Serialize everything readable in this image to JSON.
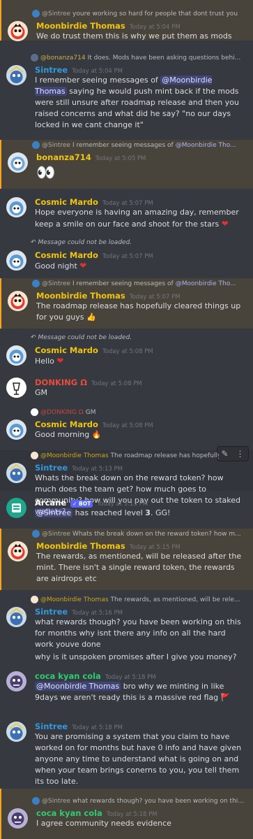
{
  "messages": [
    {
      "reply": {
        "author": "@Sintree",
        "text": "youre working so hard for people that dont trust you"
      },
      "author": "Moonbirdie Thomas",
      "time": "Today at 5:04 PM",
      "body": "We do trust them this is why we put them as mods"
    },
    {
      "reply": {
        "author": "@bonanza714",
        "text": "It does. Mods have been asking questions behi..."
      },
      "author": "Sintree",
      "time": "Today at 5:04 PM",
      "body_pre": "I remember seeing messages of ",
      "body_mention": "@Moonbirdie Thomas",
      "body_post": " saying he would push mint back if the mods were still unsure after roadmap release and then you raised concerns and what did he say? \"no our days locked in we cant change it\""
    },
    {
      "reply": {
        "author": "@Sintree",
        "text": "I remember seeing messages of ",
        "mention": "@Moonbirdie Tho..."
      },
      "author": "bonanza714",
      "time": "Today at 5:05 PM",
      "body": "👀"
    },
    {
      "author": "Cosmic Mardo",
      "time": "Today at 5:07 PM",
      "body": "Hope everyone is having an amazing day, remember keep a smile on our face and shoot for the stars",
      "emoji": "❤"
    },
    {
      "reply": {
        "text": "Message could not be loaded."
      },
      "author": "Cosmic Mardo",
      "time": "Today at 5:07 PM",
      "body": "Good night",
      "emoji": "❤"
    },
    {
      "reply": {
        "author": "@Sintree",
        "text": "I remember seeing messages of ",
        "mention": "@Moonbirdie Tho..."
      },
      "author": "Moonbirdie Thomas",
      "time": "Today at 5:07 PM",
      "body": "The roadmap release has hopefully cleared things up for you guys",
      "emoji": "👍"
    },
    {
      "reply": {
        "text": "Message could not be loaded."
      },
      "author": "Cosmic Mardo",
      "time": "Today at 5:08 PM",
      "body": "Hello",
      "emoji": "❤"
    },
    {
      "author": "DONKING Ω",
      "time": "Today at 5:08 PM",
      "body": "GM"
    },
    {
      "reply": {
        "author": "@DONKING Ω",
        "text": "GM"
      },
      "author": "Cosmic Mardo",
      "time": "Today at 5:08 PM",
      "body": "Good morning",
      "emoji": "🔥"
    },
    {
      "reply": {
        "author": "@Moonbirdie Thomas",
        "text": "The roadmap release has hopefully c..."
      },
      "author": "Sintree",
      "time": "Today at 5:13 PM",
      "body": "Whats the break down on the reward token?  how much does the team get?  how much goes to community?  how will you pay out the token to staked wallets?"
    },
    {
      "author": "Arcane",
      "bot_tag": "✓ BOT",
      "time": "Today at 5:13 PM",
      "body_mention": "@Sintree",
      "body_pre": " has reached level ",
      "body_bold": "3",
      "body_post": ". GG!"
    },
    {
      "reply": {
        "author": "@Sintree",
        "text": "Whats the break down on the reward token?  how m..."
      },
      "author": "Moonbirdie Thomas",
      "time": "Today at 5:15 PM",
      "body": "The rewards, as mentioned, will be released after the mint. There isn't a single reward token, the rewards are airdrops etc"
    },
    {
      "reply": {
        "author": "@Moonbirdie Thomas",
        "text": "The rewards, as mentioned, will be rele..."
      },
      "author": "Sintree",
      "time": "Today at 5:16 PM",
      "body": "what rewards though? you have been working on this for months why isnt there any info on all the hard work youve done",
      "body2": "why is it unspoken promises after I give you money?"
    },
    {
      "author": "coca kyan cola",
      "time": "Today at 5:18 PM",
      "body_mention": "@Moonbirdie Thomas",
      "body_post": " bro why we minting in like 9days we aren't ready this is a massive red flag",
      "emoji": "🚩"
    },
    {
      "author": "Sintree",
      "time": "Today at 5:18 PM",
      "body": "You are promising a system that you claim to have worked on for months but have 0 info and have given anyone any time to understand what is going on and when your team brings conerns to you, you tell them its too late."
    },
    {
      "reply": {
        "author": "@Sintree",
        "text": "what rewards though? you have been working on thi..."
      },
      "author": "coca kyan cola",
      "time": "Today at 5:18 PM",
      "body": "I agree community needs evidence"
    }
  ],
  "colors": {
    "moonbirdie": "#f1c40f",
    "sintree": "#3498db",
    "bonanza": "#f1c40f",
    "cosmic": "#f1c40f",
    "donking": "#e74c3c",
    "arcane": "#ffffff",
    "coca": "#2ecc71"
  }
}
